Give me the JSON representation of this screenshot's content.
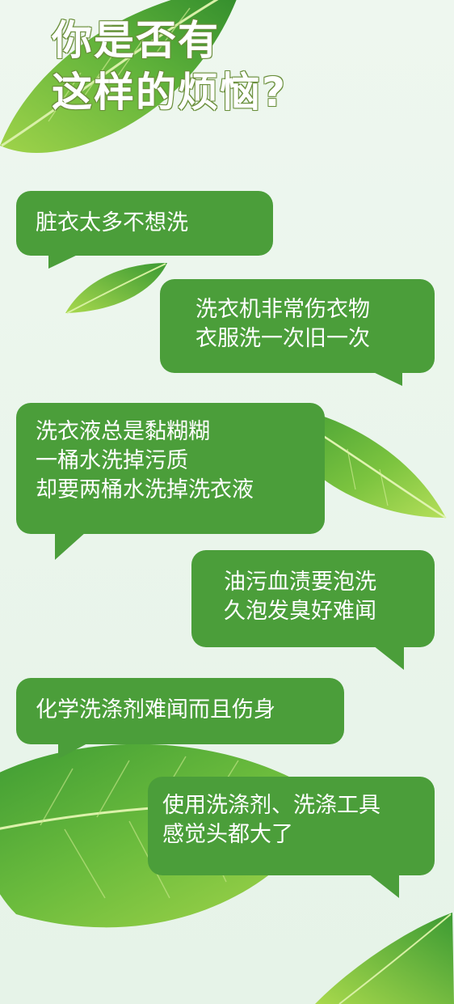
{
  "title": {
    "line1": "你是否有",
    "line2": "这样的烦恼?"
  },
  "bubbles": [
    {
      "lines": [
        "脏衣太多不想洗"
      ]
    },
    {
      "lines": [
        "洗衣机非常伤衣物",
        "衣服洗一次旧一次"
      ]
    },
    {
      "lines": [
        "洗衣液总是黏糊糊",
        "一桶水洗掉污质",
        "却要两桶水洗掉洗衣液"
      ]
    },
    {
      "lines": [
        "油污血渍要泡洗",
        "久泡发臭好难闻"
      ]
    },
    {
      "lines": [
        "化学洗涤剂难闻而且伤身"
      ]
    },
    {
      "lines": [
        "使用洗涤剂、洗涤工具",
        "感觉头都大了"
      ]
    }
  ],
  "decor": {
    "leaf_icons": [
      "top-leaf-icon",
      "small-leaf-icon",
      "mid-leaf-icon",
      "bottom-leaf-icon",
      "corner-leaf-icon"
    ],
    "colors": {
      "bubble": "#4b9e3a",
      "background": "#e8f4ea",
      "leaf_light": "#9fd34a",
      "leaf_dark": "#3b8f2f"
    }
  }
}
